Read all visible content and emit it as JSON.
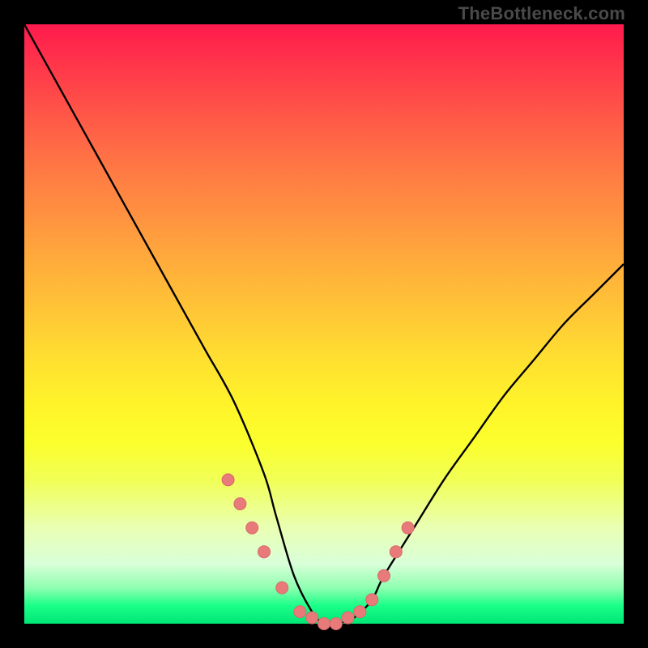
{
  "attribution": "TheBottleneck.com",
  "colors": {
    "frame": "#000000",
    "curve_stroke": "#000000",
    "marker_fill": "#e87a7a",
    "marker_stroke": "#d86a6a"
  },
  "chart_data": {
    "type": "line",
    "title": "",
    "xlabel": "",
    "ylabel": "",
    "xlim": [
      0,
      100
    ],
    "ylim": [
      0,
      100
    ],
    "grid": false,
    "legend": false,
    "x": [
      0,
      5,
      10,
      15,
      20,
      25,
      30,
      35,
      40,
      42,
      45,
      48,
      50,
      52,
      55,
      58,
      60,
      65,
      70,
      75,
      80,
      85,
      90,
      95,
      100
    ],
    "values": [
      100,
      91,
      82,
      73,
      64,
      55,
      46,
      37,
      25,
      18,
      8,
      2,
      0,
      0,
      1,
      4,
      8,
      16,
      24,
      31,
      38,
      44,
      50,
      55,
      60
    ],
    "markers_x": [
      34,
      36,
      38,
      40,
      43,
      46,
      48,
      50,
      52,
      54,
      56,
      58,
      60,
      62,
      64
    ],
    "markers_y": [
      24,
      20,
      16,
      12,
      6,
      2,
      1,
      0,
      0,
      1,
      2,
      4,
      8,
      12,
      16
    ]
  }
}
